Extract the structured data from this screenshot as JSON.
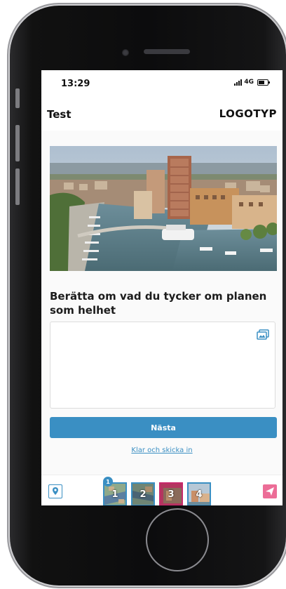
{
  "status_bar": {
    "time": "13:29",
    "network": "4G"
  },
  "app_bar": {
    "title": "Test",
    "logo": "LOGOTYP"
  },
  "question": {
    "text": "Berätta om vad du tycker om planen som helhet"
  },
  "answer": {
    "value": "",
    "image_button_icon": "image-gallery-icon"
  },
  "actions": {
    "next_label": "Nästa",
    "submit_link": "Klar och skicka in"
  },
  "bottom_bar": {
    "location_icon": "map-pin-icon",
    "send_icon": "paper-plane-icon",
    "steps": [
      {
        "label": "1",
        "active": false
      },
      {
        "label": "2",
        "active": false,
        "badge": "1"
      },
      {
        "label": "3",
        "active": true
      },
      {
        "label": "4",
        "active": false
      }
    ]
  },
  "colors": {
    "primary": "#3a8fc3",
    "accent": "#ec6d97",
    "active_step": "#c7286b"
  }
}
